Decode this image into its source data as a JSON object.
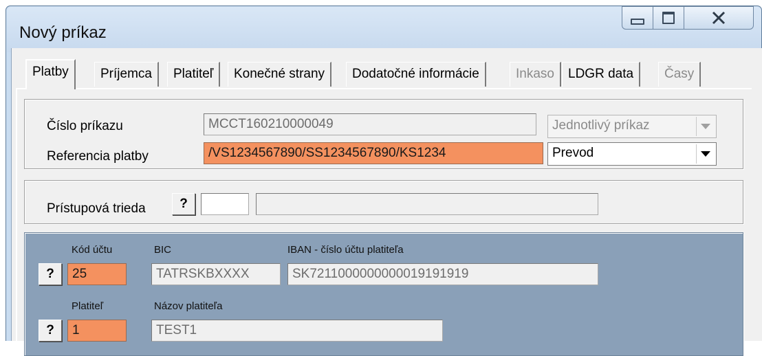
{
  "window": {
    "title": "Nový príkaz"
  },
  "tabs": [
    {
      "label": "Platby",
      "active": true,
      "enabled": true
    },
    {
      "label": "Príjemca",
      "active": false,
      "enabled": true
    },
    {
      "label": "Platiteľ",
      "active": false,
      "enabled": true
    },
    {
      "label": "Konečné strany",
      "active": false,
      "enabled": true
    },
    {
      "label": "Dodatočné informácie",
      "active": false,
      "enabled": true
    },
    {
      "label": "Inkaso",
      "active": false,
      "enabled": false
    },
    {
      "label": "LDGR data",
      "active": false,
      "enabled": true
    },
    {
      "label": "Časy",
      "active": false,
      "enabled": false
    }
  ],
  "order": {
    "number_label": "Číslo príkazu",
    "number_value": "MCCT160210000049",
    "type_selected": "Jednotlivý príkaz",
    "reference_label": "Referencia platby",
    "reference_value": "/VS1234567890/SS1234567890/KS1234",
    "method_selected": "Prevod"
  },
  "access": {
    "label": "Prístupová trieda",
    "help_label": "?",
    "code_value": "",
    "name_value": ""
  },
  "payer": {
    "account_code_label": "Kód účtu",
    "account_code_value": "25",
    "bic_label": "BIC",
    "bic_value": "TATRSKBXXXX",
    "iban_label": "IBAN - číslo účtu platiteľa",
    "iban_value": "SK7211000000000019191919",
    "payer_label": "Platiteľ",
    "payer_value": "1",
    "payer_name_label": "Názov platiteľa",
    "payer_name_value": "TEST1",
    "help_label": "?"
  },
  "colors": {
    "required_field": "#f4915f",
    "payer_panel": "#8aa0b8",
    "window_frame": "#c9dcf0"
  }
}
